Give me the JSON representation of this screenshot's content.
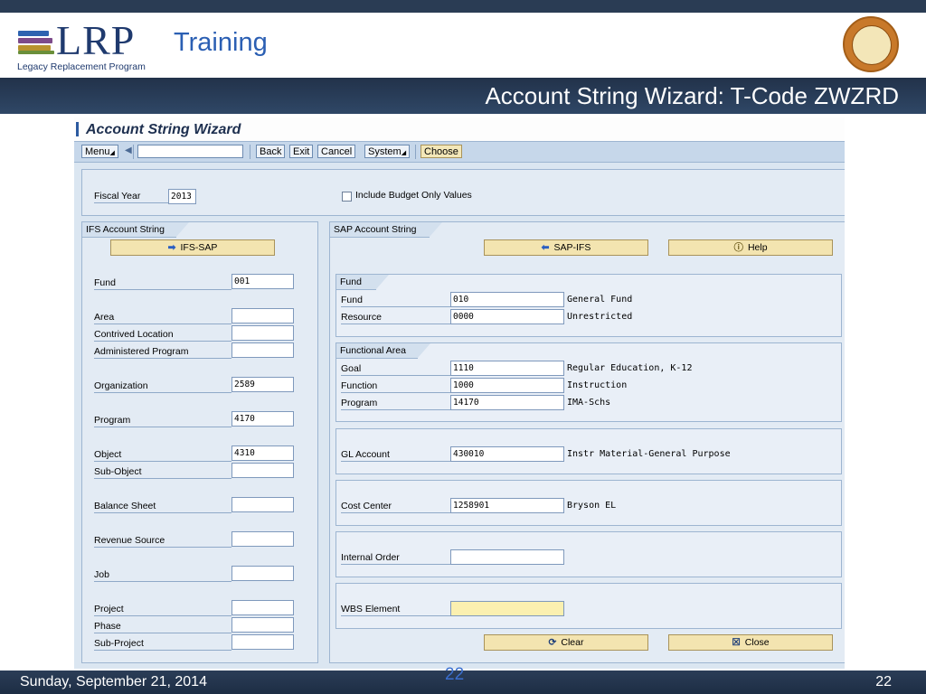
{
  "slide": {
    "logo_text": "LRP",
    "logo_training": "Training",
    "logo_subtitle": "Legacy Replacement Program",
    "title": "Account String Wizard: T-Code ZWZRD",
    "footer_date": "Sunday, September 21, 2014",
    "page_number": "22",
    "ghost_number": "22"
  },
  "window": {
    "title": "Account String Wizard",
    "toolbar": {
      "menu": "Menu",
      "back": "Back",
      "exit": "Exit",
      "cancel": "Cancel",
      "system": "System",
      "choose": "Choose"
    }
  },
  "header": {
    "fiscal_year_label": "Fiscal Year",
    "fiscal_year_value": "2013",
    "include_budget_label": "Include Budget Only Values",
    "include_budget_checked": false
  },
  "ifs": {
    "panel_title": "IFS Account String",
    "convert_button": "IFS-SAP",
    "fields": {
      "fund": {
        "label": "Fund",
        "value": "001"
      },
      "area": {
        "label": "Area",
        "value": ""
      },
      "contrived_location": {
        "label": "Contrived Location",
        "value": ""
      },
      "administered_program": {
        "label": "Administered Program",
        "value": ""
      },
      "organization": {
        "label": "Organization",
        "value": "2589"
      },
      "program": {
        "label": "Program",
        "value": "4170"
      },
      "object": {
        "label": "Object",
        "value": "4310"
      },
      "sub_object": {
        "label": "Sub-Object",
        "value": ""
      },
      "balance_sheet": {
        "label": "Balance Sheet",
        "value": ""
      },
      "revenue_source": {
        "label": "Revenue Source",
        "value": ""
      },
      "job": {
        "label": "Job",
        "value": ""
      },
      "project": {
        "label": "Project",
        "value": ""
      },
      "phase": {
        "label": "Phase",
        "value": ""
      },
      "sub_project": {
        "label": "Sub-Project",
        "value": ""
      }
    }
  },
  "sap": {
    "panel_title": "SAP Account String",
    "convert_button": "SAP-IFS",
    "help_button": "Help",
    "fund_group": {
      "title": "Fund",
      "fund": {
        "label": "Fund",
        "value": "010",
        "desc": "General Fund"
      },
      "resource": {
        "label": "Resource",
        "value": "0000",
        "desc": "Unrestricted"
      }
    },
    "functional_area": {
      "title": "Functional Area",
      "goal": {
        "label": "Goal",
        "value": "1110",
        "desc": "Regular Education, K-12"
      },
      "function": {
        "label": "Function",
        "value": "1000",
        "desc": "Instruction"
      },
      "program": {
        "label": "Program",
        "value": "14170",
        "desc": "IMA-Schs"
      }
    },
    "gl_account": {
      "label": "GL Account",
      "value": "430010",
      "desc": "Instr Material-General Purpose"
    },
    "cost_center": {
      "label": "Cost Center",
      "value": "1258901",
      "desc": "Bryson EL"
    },
    "internal_order": {
      "label": "Internal Order",
      "value": ""
    },
    "wbs_element": {
      "label": "WBS Element",
      "value": ""
    },
    "clear_button": "Clear",
    "close_button": "Close"
  },
  "colors": {
    "slide_bar": "#22324a",
    "sap_background": "#dbe6f1",
    "button_gold": "#f3e4b0",
    "required_field": "#fbf0b0"
  }
}
